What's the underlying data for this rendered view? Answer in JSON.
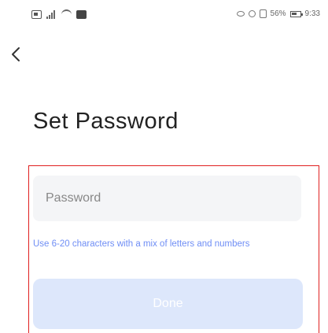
{
  "status_bar": {
    "battery_percent": "56%",
    "time": "9:33",
    "icons_left": [
      "sim-icon",
      "signal-icon",
      "wifi-icon",
      "message-icon"
    ],
    "icons_right": [
      "eye-icon",
      "alarm-icon",
      "vibrate-icon",
      "battery-icon"
    ]
  },
  "nav": {
    "back_icon": "chevron-left-icon"
  },
  "page": {
    "title": "Set Password"
  },
  "form": {
    "password": {
      "value": "",
      "placeholder": "Password"
    },
    "hint": "Use 6-20 characters with a mix of letters and numbers",
    "done_label": "Done"
  },
  "colors": {
    "hint": "#6f8ef5",
    "button_disabled_bg": "#dde7fb",
    "field_bg": "#f4f5f7",
    "highlight_border": "#e02020"
  }
}
